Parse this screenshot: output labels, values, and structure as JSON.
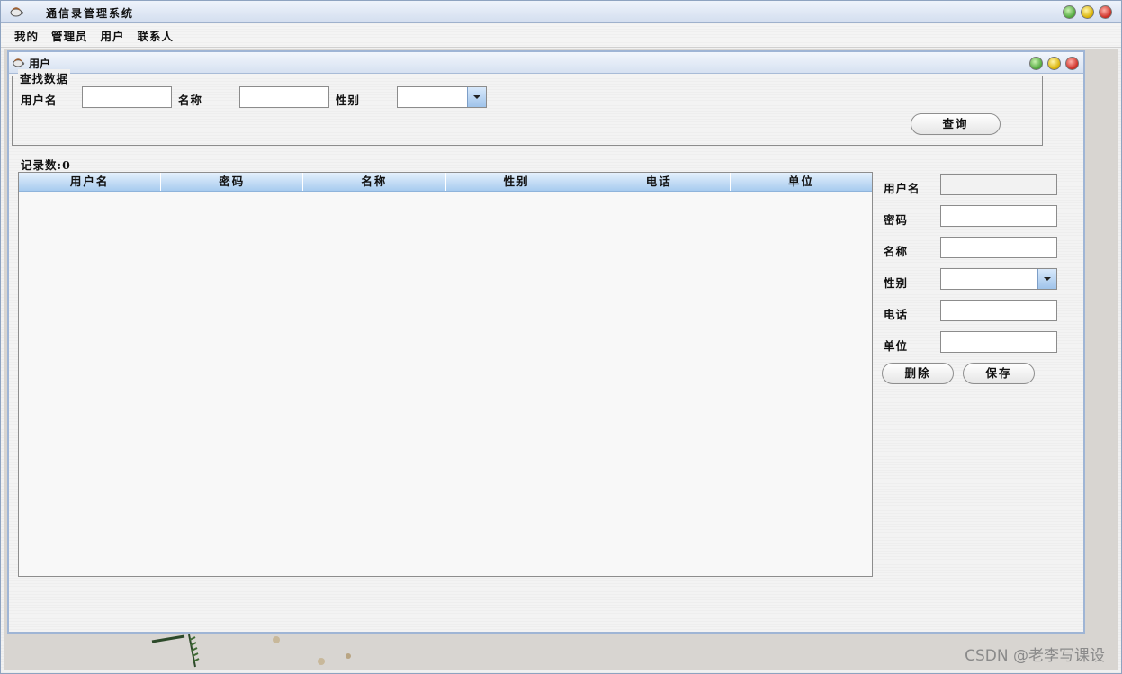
{
  "window": {
    "title": "通信录管理系统"
  },
  "menubar": {
    "items": [
      {
        "label": "我的"
      },
      {
        "label": "管理员"
      },
      {
        "label": "用户"
      },
      {
        "label": "联系人"
      }
    ]
  },
  "frame": {
    "title": "用户"
  },
  "search": {
    "legend": "查找数据",
    "username_label": "用户名",
    "name_label": "名称",
    "gender_label": "性别",
    "username_value": "",
    "name_value": "",
    "gender_value": "",
    "query_button": "查询"
  },
  "records": {
    "count_label": "记录数:0"
  },
  "table": {
    "columns": [
      "用户名",
      "密码",
      "名称",
      "性别",
      "电话",
      "单位"
    ],
    "rows": []
  },
  "detail": {
    "username_label": "用户名",
    "password_label": "密码",
    "name_label": "名称",
    "gender_label": "性别",
    "phone_label": "电话",
    "company_label": "单位",
    "username_value": "",
    "password_value": "",
    "name_value": "",
    "gender_value": "",
    "phone_value": "",
    "company_value": "",
    "delete_button": "删除",
    "save_button": "保存"
  },
  "watermark": {
    "text": "CSDN @老李写课设"
  },
  "colors": {
    "header_top": "#e4f0fc",
    "header_bottom": "#a7cbef",
    "frame_border": "#9fb5d5"
  }
}
